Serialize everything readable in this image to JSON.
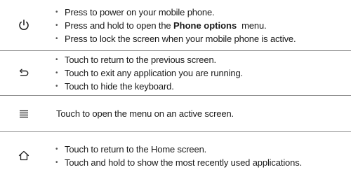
{
  "rows": [
    {
      "icon": "power-icon",
      "items": [
        {
          "text": "Press to power on your mobile phone."
        },
        {
          "prefix": "Press and hold to open the ",
          "term": "Phone options",
          "suffix": "  menu."
        },
        {
          "text": "Press to lock the screen when your mobile phone is active."
        }
      ]
    },
    {
      "icon": "back-icon",
      "items": [
        {
          "text": "Touch to return to the previous screen."
        },
        {
          "text": "Touch to exit any application you are running."
        },
        {
          "text": "Touch to hide the keyboard."
        }
      ]
    },
    {
      "icon": "menu-icon",
      "text": "Touch to open the menu on an active screen."
    },
    {
      "icon": "home-icon",
      "items": [
        {
          "text": "Touch to return to the Home screen."
        },
        {
          "text": "Touch and hold to show the most recently used applications."
        }
      ]
    }
  ]
}
